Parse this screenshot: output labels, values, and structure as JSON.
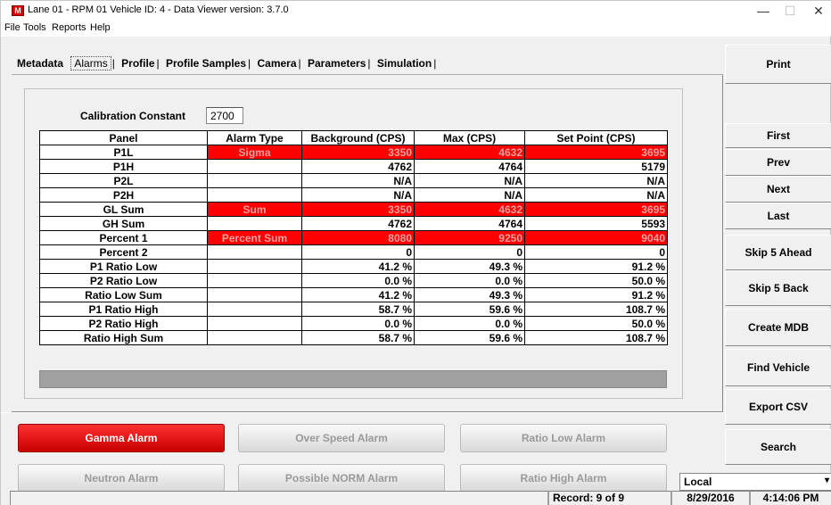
{
  "window": {
    "title": "Lane 01 - RPM 01  Vehicle ID: 4 - Data Viewer   version: 3.7.0",
    "icon_letter": "M",
    "minimize": "—",
    "maximize": "☐",
    "close": "✕"
  },
  "menu": [
    "File",
    "Tools",
    "Reports",
    "Help"
  ],
  "tabs": [
    {
      "label": "Metadata"
    },
    {
      "label": "Alarms",
      "active": true
    },
    {
      "label": "Profile"
    },
    {
      "label": "Profile Samples"
    },
    {
      "label": "Camera"
    },
    {
      "label": "Parameters"
    },
    {
      "label": "Simulation"
    }
  ],
  "calibration": {
    "label": "Calibration Constant",
    "value": "2700"
  },
  "table": {
    "headers": [
      "Panel",
      "Alarm Type",
      "Background (CPS)",
      "Max (CPS)",
      "Set Point (CPS)"
    ],
    "rows": [
      {
        "panel": "P1L",
        "type": "Sigma",
        "bg": "3350",
        "max": "4632",
        "sp": "3695",
        "alarm": true
      },
      {
        "panel": "P1H",
        "type": "",
        "bg": "4762",
        "max": "4764",
        "sp": "5179",
        "alarm": false
      },
      {
        "panel": "P2L",
        "type": "",
        "bg": "N/A",
        "max": "N/A",
        "sp": "N/A",
        "alarm": false
      },
      {
        "panel": "P2H",
        "type": "",
        "bg": "N/A",
        "max": "N/A",
        "sp": "N/A",
        "alarm": false
      },
      {
        "panel": "GL Sum",
        "type": "Sum",
        "bg": "3350",
        "max": "4632",
        "sp": "3695",
        "alarm": true
      },
      {
        "panel": "GH Sum",
        "type": "",
        "bg": "4762",
        "max": "4764",
        "sp": "5593",
        "alarm": false
      },
      {
        "panel": "Percent 1",
        "type": "Percent Sum",
        "bg": "8080",
        "max": "9250",
        "sp": "9040",
        "alarm": true
      },
      {
        "panel": "Percent 2",
        "type": "",
        "bg": "0",
        "max": "0",
        "sp": "0",
        "alarm": false
      },
      {
        "panel": "P1 Ratio Low",
        "type": "",
        "bg": "41.2 %",
        "max": "49.3  %",
        "sp": "91.2 %",
        "alarm": false
      },
      {
        "panel": "P2 Ratio Low",
        "type": "",
        "bg": "0.0 %",
        "max": "0.0  %",
        "sp": "50.0 %",
        "alarm": false
      },
      {
        "panel": "Ratio Low Sum",
        "type": "",
        "bg": "41.2 %",
        "max": "49.3  %",
        "sp": "91.2 %",
        "alarm": false
      },
      {
        "panel": "P1 Ratio High",
        "type": "",
        "bg": "58.7 %",
        "max": "59.6  %",
        "sp": "108.7 %",
        "alarm": false
      },
      {
        "panel": "P2 Ratio High",
        "type": "",
        "bg": "0.0 %",
        "max": "0.0  %",
        "sp": "50.0 %",
        "alarm": false
      },
      {
        "panel": "Ratio High Sum",
        "type": "",
        "bg": "58.7 %",
        "max": "59.6  %",
        "sp": "108.7 %",
        "alarm": false
      }
    ]
  },
  "sidebar": {
    "print": "Print",
    "first": "First",
    "prev": "Prev",
    "next": "Next",
    "last": "Last",
    "skip_ahead": "Skip 5 Ahead",
    "skip_back": "Skip 5 Back",
    "create_mdb": "Create MDB",
    "find_vehicle": "Find Vehicle",
    "export_csv": "Export CSV",
    "search": "Search"
  },
  "alarm_buttons": {
    "gamma": "Gamma Alarm",
    "over_speed": "Over Speed Alarm",
    "ratio_low": "Ratio Low Alarm",
    "neutron": "Neutron Alarm",
    "possible_norm": "Possible NORM Alarm",
    "ratio_high": "Ratio High Alarm"
  },
  "location": {
    "value": "Local",
    "arrow": "▾"
  },
  "status": {
    "record": "Record: 9 of 9",
    "date": "8/29/2016",
    "time": "4:14:06 PM"
  },
  "colors": {
    "alarm_red": "#ff0000",
    "alarm_text": "#f0a0a0"
  }
}
